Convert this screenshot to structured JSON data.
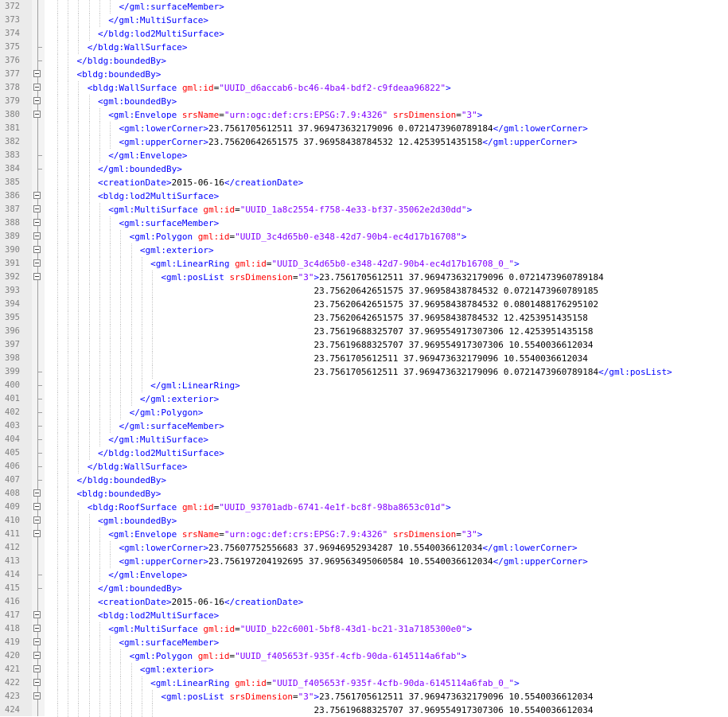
{
  "editor": {
    "colors": {
      "tag": "#0000ff",
      "attribute_name": "#ff0000",
      "attribute_value": "#8000ff",
      "text": "#000000",
      "line_number": "#808080"
    },
    "lines": [
      {
        "n": "372",
        "indent": 6,
        "fold": "none",
        "segs": [
          {
            "c": "t",
            "s": "</gml:surfaceMember>"
          }
        ]
      },
      {
        "n": "373",
        "indent": 5,
        "fold": "none",
        "segs": [
          {
            "c": "t",
            "s": "</gml:MultiSurface>"
          }
        ]
      },
      {
        "n": "374",
        "indent": 4,
        "fold": "none",
        "segs": [
          {
            "c": "t",
            "s": "</bldg:lod2MultiSurface>"
          }
        ]
      },
      {
        "n": "375",
        "indent": 3,
        "fold": "end",
        "segs": [
          {
            "c": "t",
            "s": "</bldg:WallSurface>"
          }
        ]
      },
      {
        "n": "376",
        "indent": 2,
        "fold": "end",
        "segs": [
          {
            "c": "t",
            "s": "</bldg:boundedBy>"
          }
        ]
      },
      {
        "n": "377",
        "indent": 2,
        "fold": "open",
        "segs": [
          {
            "c": "t",
            "s": "<bldg:boundedBy>"
          }
        ]
      },
      {
        "n": "378",
        "indent": 3,
        "fold": "open",
        "segs": [
          {
            "c": "t",
            "s": "<bldg:WallSurface "
          },
          {
            "c": "a",
            "s": "gml:id"
          },
          {
            "c": "x",
            "s": "="
          },
          {
            "c": "v",
            "s": "\"UUID_d6accab6-bc46-4ba4-bdf2-c9fdeaa96822\""
          },
          {
            "c": "t",
            "s": ">"
          }
        ]
      },
      {
        "n": "379",
        "indent": 4,
        "fold": "open",
        "segs": [
          {
            "c": "t",
            "s": "<gml:boundedBy>"
          }
        ]
      },
      {
        "n": "380",
        "indent": 5,
        "fold": "open",
        "segs": [
          {
            "c": "t",
            "s": "<gml:Envelope "
          },
          {
            "c": "a",
            "s": "srsName"
          },
          {
            "c": "x",
            "s": "="
          },
          {
            "c": "v",
            "s": "\"urn:ogc:def:crs:EPSG:7.9:4326\""
          },
          {
            "c": "a",
            "s": " srsDimension"
          },
          {
            "c": "x",
            "s": "="
          },
          {
            "c": "v",
            "s": "\"3\""
          },
          {
            "c": "t",
            "s": ">"
          }
        ]
      },
      {
        "n": "381",
        "indent": 6,
        "fold": "none",
        "segs": [
          {
            "c": "t",
            "s": "<gml:lowerCorner>"
          },
          {
            "c": "x",
            "s": "23.7561705612511 37.969473632179096 0.0721473960789184"
          },
          {
            "c": "t",
            "s": "</gml:lowerCorner>"
          }
        ]
      },
      {
        "n": "382",
        "indent": 6,
        "fold": "none",
        "segs": [
          {
            "c": "t",
            "s": "<gml:upperCorner>"
          },
          {
            "c": "x",
            "s": "23.75620642651575 37.96958438784532 12.4253951435158"
          },
          {
            "c": "t",
            "s": "</gml:upperCorner>"
          }
        ]
      },
      {
        "n": "383",
        "indent": 5,
        "fold": "end",
        "segs": [
          {
            "c": "t",
            "s": "</gml:Envelope>"
          }
        ]
      },
      {
        "n": "384",
        "indent": 4,
        "fold": "end",
        "segs": [
          {
            "c": "t",
            "s": "</gml:boundedBy>"
          }
        ]
      },
      {
        "n": "385",
        "indent": 4,
        "fold": "none",
        "segs": [
          {
            "c": "t",
            "s": "<creationDate>"
          },
          {
            "c": "x",
            "s": "2015-06-16"
          },
          {
            "c": "t",
            "s": "</creationDate>"
          }
        ]
      },
      {
        "n": "386",
        "indent": 4,
        "fold": "open",
        "segs": [
          {
            "c": "t",
            "s": "<bldg:lod2MultiSurface>"
          }
        ]
      },
      {
        "n": "387",
        "indent": 5,
        "fold": "open",
        "segs": [
          {
            "c": "t",
            "s": "<gml:MultiSurface "
          },
          {
            "c": "a",
            "s": "gml:id"
          },
          {
            "c": "x",
            "s": "="
          },
          {
            "c": "v",
            "s": "\"UUID_1a8c2554-f758-4e33-bf37-35062e2d30dd\""
          },
          {
            "c": "t",
            "s": ">"
          }
        ]
      },
      {
        "n": "388",
        "indent": 6,
        "fold": "open",
        "segs": [
          {
            "c": "t",
            "s": "<gml:surfaceMember>"
          }
        ]
      },
      {
        "n": "389",
        "indent": 7,
        "fold": "open",
        "segs": [
          {
            "c": "t",
            "s": "<gml:Polygon "
          },
          {
            "c": "a",
            "s": "gml:id"
          },
          {
            "c": "x",
            "s": "="
          },
          {
            "c": "v",
            "s": "\"UUID_3c4d65b0-e348-42d7-90b4-ec4d17b16708\""
          },
          {
            "c": "t",
            "s": ">"
          }
        ]
      },
      {
        "n": "390",
        "indent": 8,
        "fold": "open",
        "segs": [
          {
            "c": "t",
            "s": "<gml:exterior>"
          }
        ]
      },
      {
        "n": "391",
        "indent": 9,
        "fold": "open",
        "segs": [
          {
            "c": "t",
            "s": "<gml:LinearRing "
          },
          {
            "c": "a",
            "s": "gml:id"
          },
          {
            "c": "x",
            "s": "="
          },
          {
            "c": "v",
            "s": "\"UUID_3c4d65b0-e348-42d7-90b4-ec4d17b16708_0_\""
          },
          {
            "c": "t",
            "s": ">"
          }
        ]
      },
      {
        "n": "392",
        "indent": 10,
        "fold": "open",
        "segs": [
          {
            "c": "t",
            "s": "<gml:posList "
          },
          {
            "c": "a",
            "s": "srsDimension"
          },
          {
            "c": "x",
            "s": "="
          },
          {
            "c": "v",
            "s": "\"3\""
          },
          {
            "c": "t",
            "s": ">"
          },
          {
            "c": "x",
            "s": "23.7561705612511 37.969473632179096 0.0721473960789184"
          }
        ]
      },
      {
        "n": "393",
        "indent": 10,
        "fold": "none",
        "segs": [
          {
            "c": "x",
            "s": "                             23.75620642651575 37.96958438784532 0.0721473960789185"
          }
        ]
      },
      {
        "n": "394",
        "indent": 10,
        "fold": "none",
        "segs": [
          {
            "c": "x",
            "s": "                             23.75620642651575 37.96958438784532 0.0801488176295102"
          }
        ]
      },
      {
        "n": "395",
        "indent": 10,
        "fold": "none",
        "segs": [
          {
            "c": "x",
            "s": "                             23.75620642651575 37.96958438784532 12.4253951435158"
          }
        ]
      },
      {
        "n": "396",
        "indent": 10,
        "fold": "none",
        "segs": [
          {
            "c": "x",
            "s": "                             23.75619688325707 37.969554917307306 12.4253951435158"
          }
        ]
      },
      {
        "n": "397",
        "indent": 10,
        "fold": "none",
        "segs": [
          {
            "c": "x",
            "s": "                             23.75619688325707 37.969554917307306 10.5540036612034"
          }
        ]
      },
      {
        "n": "398",
        "indent": 10,
        "fold": "none",
        "segs": [
          {
            "c": "x",
            "s": "                             23.7561705612511 37.969473632179096 10.5540036612034"
          }
        ]
      },
      {
        "n": "399",
        "indent": 10,
        "fold": "end",
        "segs": [
          {
            "c": "x",
            "s": "                             23.7561705612511 37.969473632179096 0.0721473960789184"
          },
          {
            "c": "t",
            "s": "</gml:posList>"
          }
        ]
      },
      {
        "n": "400",
        "indent": 9,
        "fold": "end",
        "segs": [
          {
            "c": "t",
            "s": "</gml:LinearRing>"
          }
        ]
      },
      {
        "n": "401",
        "indent": 8,
        "fold": "end",
        "segs": [
          {
            "c": "t",
            "s": "</gml:exterior>"
          }
        ]
      },
      {
        "n": "402",
        "indent": 7,
        "fold": "end",
        "segs": [
          {
            "c": "t",
            "s": "</gml:Polygon>"
          }
        ]
      },
      {
        "n": "403",
        "indent": 6,
        "fold": "end",
        "segs": [
          {
            "c": "t",
            "s": "</gml:surfaceMember>"
          }
        ]
      },
      {
        "n": "404",
        "indent": 5,
        "fold": "end",
        "segs": [
          {
            "c": "t",
            "s": "</gml:MultiSurface>"
          }
        ]
      },
      {
        "n": "405",
        "indent": 4,
        "fold": "end",
        "segs": [
          {
            "c": "t",
            "s": "</bldg:lod2MultiSurface>"
          }
        ]
      },
      {
        "n": "406",
        "indent": 3,
        "fold": "end",
        "segs": [
          {
            "c": "t",
            "s": "</bldg:WallSurface>"
          }
        ]
      },
      {
        "n": "407",
        "indent": 2,
        "fold": "end",
        "segs": [
          {
            "c": "t",
            "s": "</bldg:boundedBy>"
          }
        ]
      },
      {
        "n": "408",
        "indent": 2,
        "fold": "open",
        "segs": [
          {
            "c": "t",
            "s": "<bldg:boundedBy>"
          }
        ]
      },
      {
        "n": "409",
        "indent": 3,
        "fold": "open",
        "segs": [
          {
            "c": "t",
            "s": "<bldg:RoofSurface "
          },
          {
            "c": "a",
            "s": "gml:id"
          },
          {
            "c": "x",
            "s": "="
          },
          {
            "c": "v",
            "s": "\"UUID_93701adb-6741-4e1f-bc8f-98ba8653c01d\""
          },
          {
            "c": "t",
            "s": ">"
          }
        ]
      },
      {
        "n": "410",
        "indent": 4,
        "fold": "open",
        "segs": [
          {
            "c": "t",
            "s": "<gml:boundedBy>"
          }
        ]
      },
      {
        "n": "411",
        "indent": 5,
        "fold": "open",
        "segs": [
          {
            "c": "t",
            "s": "<gml:Envelope "
          },
          {
            "c": "a",
            "s": "srsName"
          },
          {
            "c": "x",
            "s": "="
          },
          {
            "c": "v",
            "s": "\"urn:ogc:def:crs:EPSG:7.9:4326\""
          },
          {
            "c": "a",
            "s": " srsDimension"
          },
          {
            "c": "x",
            "s": "="
          },
          {
            "c": "v",
            "s": "\"3\""
          },
          {
            "c": "t",
            "s": ">"
          }
        ]
      },
      {
        "n": "412",
        "indent": 6,
        "fold": "none",
        "segs": [
          {
            "c": "t",
            "s": "<gml:lowerCorner>"
          },
          {
            "c": "x",
            "s": "23.75607752556683 37.96946952934287 10.5540036612034"
          },
          {
            "c": "t",
            "s": "</gml:lowerCorner>"
          }
        ]
      },
      {
        "n": "413",
        "indent": 6,
        "fold": "none",
        "segs": [
          {
            "c": "t",
            "s": "<gml:upperCorner>"
          },
          {
            "c": "x",
            "s": "23.756197204192695 37.969563495060584 10.5540036612034"
          },
          {
            "c": "t",
            "s": "</gml:upperCorner>"
          }
        ]
      },
      {
        "n": "414",
        "indent": 5,
        "fold": "end",
        "segs": [
          {
            "c": "t",
            "s": "</gml:Envelope>"
          }
        ]
      },
      {
        "n": "415",
        "indent": 4,
        "fold": "end",
        "segs": [
          {
            "c": "t",
            "s": "</gml:boundedBy>"
          }
        ]
      },
      {
        "n": "416",
        "indent": 4,
        "fold": "none",
        "segs": [
          {
            "c": "t",
            "s": "<creationDate>"
          },
          {
            "c": "x",
            "s": "2015-06-16"
          },
          {
            "c": "t",
            "s": "</creationDate>"
          }
        ]
      },
      {
        "n": "417",
        "indent": 4,
        "fold": "open",
        "segs": [
          {
            "c": "t",
            "s": "<bldg:lod2MultiSurface>"
          }
        ]
      },
      {
        "n": "418",
        "indent": 5,
        "fold": "open",
        "segs": [
          {
            "c": "t",
            "s": "<gml:MultiSurface "
          },
          {
            "c": "a",
            "s": "gml:id"
          },
          {
            "c": "x",
            "s": "="
          },
          {
            "c": "v",
            "s": "\"UUID_b22c6001-5bf8-43d1-bc21-31a7185300e0\""
          },
          {
            "c": "t",
            "s": ">"
          }
        ]
      },
      {
        "n": "419",
        "indent": 6,
        "fold": "open",
        "segs": [
          {
            "c": "t",
            "s": "<gml:surfaceMember>"
          }
        ]
      },
      {
        "n": "420",
        "indent": 7,
        "fold": "open",
        "segs": [
          {
            "c": "t",
            "s": "<gml:Polygon "
          },
          {
            "c": "a",
            "s": "gml:id"
          },
          {
            "c": "x",
            "s": "="
          },
          {
            "c": "v",
            "s": "\"UUID_f405653f-935f-4cfb-90da-6145114a6fab\""
          },
          {
            "c": "t",
            "s": ">"
          }
        ]
      },
      {
        "n": "421",
        "indent": 8,
        "fold": "open",
        "segs": [
          {
            "c": "t",
            "s": "<gml:exterior>"
          }
        ]
      },
      {
        "n": "422",
        "indent": 9,
        "fold": "open",
        "segs": [
          {
            "c": "t",
            "s": "<gml:LinearRing "
          },
          {
            "c": "a",
            "s": "gml:id"
          },
          {
            "c": "x",
            "s": "="
          },
          {
            "c": "v",
            "s": "\"UUID_f405653f-935f-4cfb-90da-6145114a6fab_0_\""
          },
          {
            "c": "t",
            "s": ">"
          }
        ]
      },
      {
        "n": "423",
        "indent": 10,
        "fold": "open",
        "segs": [
          {
            "c": "t",
            "s": "<gml:posList "
          },
          {
            "c": "a",
            "s": "srsDimension"
          },
          {
            "c": "x",
            "s": "="
          },
          {
            "c": "v",
            "s": "\"3\""
          },
          {
            "c": "t",
            "s": ">"
          },
          {
            "c": "x",
            "s": "23.7561705612511 37.969473632179096 10.5540036612034"
          }
        ]
      },
      {
        "n": "424",
        "indent": 10,
        "fold": "none",
        "segs": [
          {
            "c": "x",
            "s": "                             23.75619688325707 37.969554917307306 10.5540036612034"
          }
        ]
      }
    ]
  }
}
